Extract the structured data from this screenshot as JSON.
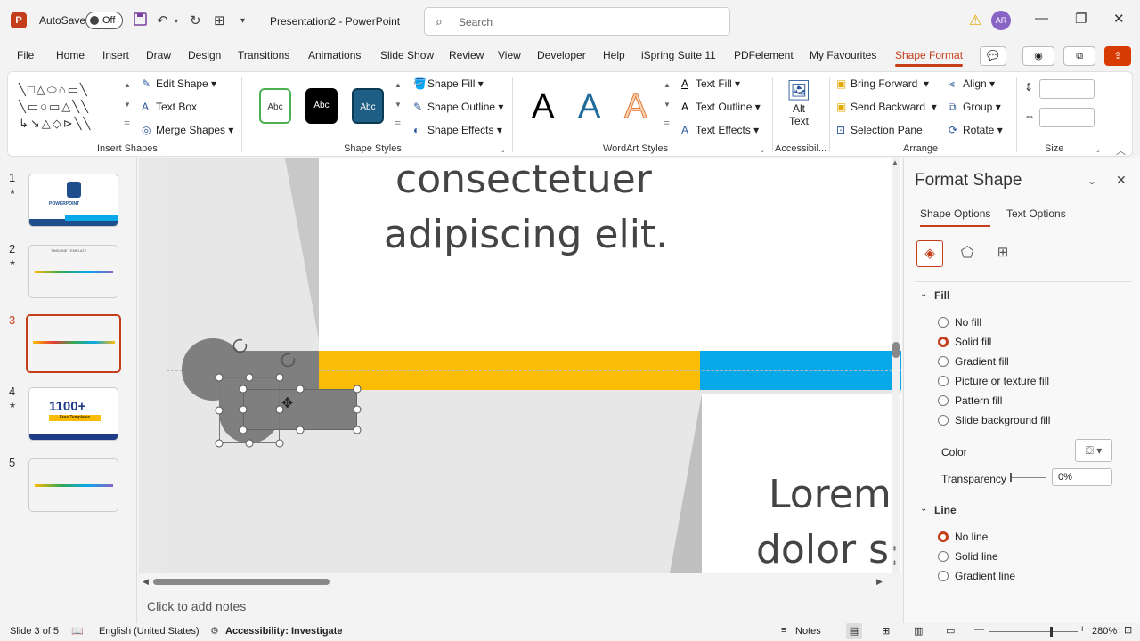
{
  "titlebar": {
    "app_logo": "P",
    "autosave_label": "AutoSave",
    "autosave_state": "Off",
    "document_title": "Presentation2  -  PowerPoint",
    "search_placeholder": "Search",
    "user_initials": "AR"
  },
  "tabs": [
    "File",
    "Home",
    "Insert",
    "Draw",
    "Design",
    "Transitions",
    "Animations",
    "Slide Show",
    "Review",
    "View",
    "Developer",
    "Help",
    "iSpring Suite 11",
    "PDFelement",
    "My Favourites",
    "Shape Format"
  ],
  "active_tab": "Shape Format",
  "ribbon": {
    "insert_shapes": {
      "label": "Insert Shapes",
      "edit_shape": "Edit Shape",
      "text_box": "Text Box",
      "merge_shapes": "Merge Shapes"
    },
    "shape_styles": {
      "label": "Shape Styles",
      "preset_label": "Abc",
      "shape_fill": "Shape Fill",
      "shape_outline": "Shape Outline",
      "shape_effects": "Shape Effects"
    },
    "wordart_styles": {
      "label": "WordArt Styles",
      "letter": "A",
      "text_fill": "Text Fill",
      "text_outline": "Text Outline",
      "text_effects": "Text Effects"
    },
    "accessibility": {
      "label": "Accessibil...",
      "alt_text_line1": "Alt",
      "alt_text_line2": "Text"
    },
    "arrange": {
      "label": "Arrange",
      "bring_forward": "Bring Forward",
      "send_backward": "Send Backward",
      "selection_pane": "Selection Pane",
      "align": "Align",
      "group": "Group",
      "rotate": "Rotate"
    },
    "size": {
      "label": "Size"
    }
  },
  "slides": [
    {
      "num": "1",
      "star": "★",
      "thumb_text": "POWERPOINT"
    },
    {
      "num": "2",
      "star": "★",
      "thumb_text": "TIMELINE TEMPLATE"
    },
    {
      "num": "3",
      "star": "",
      "thumb_text": ""
    },
    {
      "num": "4",
      "star": "★",
      "thumb_text": "1100+",
      "thumb_sub": "Free Templates"
    },
    {
      "num": "5",
      "star": "",
      "thumb_text": ""
    }
  ],
  "canvas": {
    "text_top_line1": "consectetuer",
    "text_top_line2": "adipiscing elit.",
    "text_bottom_line1": "Lorem",
    "text_bottom_line2": "dolor s",
    "colors": {
      "yellow": "#fbbc05",
      "blue": "#09a8e8",
      "grey_shape": "#7f7f7f"
    }
  },
  "notes_placeholder": "Click to add notes",
  "format_panel": {
    "title": "Format Shape",
    "tab_shape": "Shape Options",
    "tab_text": "Text Options",
    "fill_section": "Fill",
    "fill_options": [
      "No fill",
      "Solid fill",
      "Gradient fill",
      "Picture or texture fill",
      "Pattern fill",
      "Slide background fill"
    ],
    "fill_selected": "Solid fill",
    "color_label": "Color",
    "transparency_label": "Transparency",
    "transparency_value": "0%",
    "line_section": "Line",
    "line_options": [
      "No line",
      "Solid line",
      "Gradient line"
    ],
    "line_selected": "No line"
  },
  "statusbar": {
    "slide_info": "Slide 3 of 5",
    "language": "English (United States)",
    "accessibility": "Accessibility: Investigate",
    "notes": "Notes",
    "zoom": "280%"
  }
}
